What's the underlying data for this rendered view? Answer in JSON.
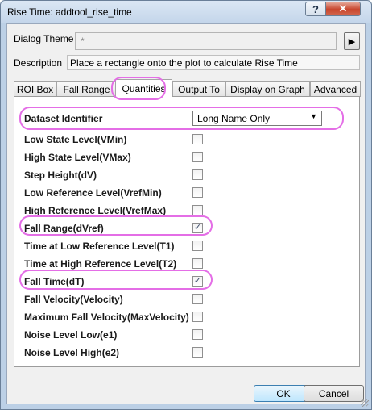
{
  "window": {
    "title": "Rise Time: addtool_rise_time",
    "help_label": "?",
    "close_label": "✕"
  },
  "theme": {
    "label": "Dialog Theme",
    "value": "*",
    "arrow": "▶"
  },
  "description": {
    "label": "Description",
    "value": "Place a rectangle onto the plot to calculate Rise Time"
  },
  "tabs": [
    {
      "label": "ROI Box",
      "active": false
    },
    {
      "label": "Fall Range",
      "active": false
    },
    {
      "label": "Quantities",
      "active": true
    },
    {
      "label": "Output To",
      "active": false
    },
    {
      "label": "Display on Graph",
      "active": false
    },
    {
      "label": "Advanced",
      "active": false
    }
  ],
  "quantities": {
    "dataset_identifier": {
      "label": "Dataset Identifier",
      "value": "Long Name Only",
      "arrow": "▼"
    },
    "rows": [
      {
        "label": "Low State Level(VMin)",
        "checked": false,
        "mark": ""
      },
      {
        "label": "High State Level(VMax)",
        "checked": false,
        "mark": ""
      },
      {
        "label": "Step Height(dV)",
        "checked": false,
        "mark": ""
      },
      {
        "label": "Low Reference Level(VrefMin)",
        "checked": false,
        "mark": ""
      },
      {
        "label": "High Reference Level(VrefMax)",
        "checked": false,
        "mark": ""
      },
      {
        "label": "Fall Range(dVref)",
        "checked": true,
        "mark": "✓"
      },
      {
        "label": "Time at Low Reference Level(T1)",
        "checked": false,
        "mark": ""
      },
      {
        "label": "Time at High Reference Level(T2)",
        "checked": false,
        "mark": ""
      },
      {
        "label": "Fall Time(dT)",
        "checked": true,
        "mark": "✓"
      },
      {
        "label": "Fall Velocity(Velocity)",
        "checked": false,
        "mark": ""
      },
      {
        "label": "Maximum Fall Velocity(MaxVelocity)",
        "checked": false,
        "mark": ""
      },
      {
        "label": "Noise Level Low(e1)",
        "checked": false,
        "mark": ""
      },
      {
        "label": "Noise Level High(e2)",
        "checked": false,
        "mark": ""
      }
    ]
  },
  "buttons": {
    "ok": "OK",
    "cancel": "Cancel"
  },
  "colors": {
    "highlight": "#e46ee6",
    "title_bar": "#c3d5ea",
    "close_button": "#c8452c"
  }
}
